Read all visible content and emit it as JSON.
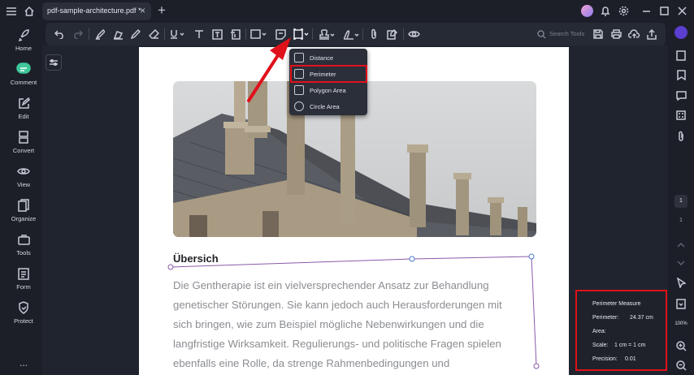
{
  "tab": {
    "title": "pdf-sample-architecture.pdf *",
    "close": "×",
    "new": "+"
  },
  "sidebar": {
    "items": [
      {
        "label": "Home",
        "icon": "rocket-icon"
      },
      {
        "label": "Comment",
        "icon": "comment-icon"
      },
      {
        "label": "Edit",
        "icon": "edit-icon"
      },
      {
        "label": "Convert",
        "icon": "convert-icon"
      },
      {
        "label": "View",
        "icon": "view-icon"
      },
      {
        "label": "Organize",
        "icon": "organize-icon"
      },
      {
        "label": "Tools",
        "icon": "tools-icon"
      },
      {
        "label": "Form",
        "icon": "form-icon"
      },
      {
        "label": "Protect",
        "icon": "shield-icon"
      }
    ],
    "more": "..."
  },
  "toolbar": {
    "search_placeholder": "Search Tools"
  },
  "measure_menu": {
    "items": [
      "Distance",
      "Perimeter",
      "Polygon Area",
      "Circle Area"
    ],
    "selected": "Perimeter"
  },
  "document": {
    "heading": "Übersich",
    "paragraph": [
      "Die Gentherapie ist ein vielversprechender Ansatz zur Behandlung",
      "genetischer Störungen. Sie kann jedoch auch Herausforderungen mit",
      "sich bringen, wie zum Beispiel mögliche Nebenwirkungen und die",
      "langfristige Wirksamkeit. Regulierungs- und politische Fragen spielen",
      "ebenfalls eine Rolle, da strenge Rahmenbedingungen und"
    ]
  },
  "measure_panel": {
    "title": "Perimeter Measure",
    "perimeter_label": "Perimeter:",
    "perimeter_value": "24.37 cm",
    "area_label": "Area:",
    "scale_label": "Scale:",
    "scale_value": "1 cm = 1 cm",
    "precision_label": "Precision:",
    "precision_value": "0.01"
  },
  "pager": {
    "current": "1",
    "total": "1",
    "zoom": "100%"
  },
  "colors": {
    "highlight": "#e0111b",
    "accent": "#7b4fd6",
    "measure_line": "#8a5aa8"
  }
}
